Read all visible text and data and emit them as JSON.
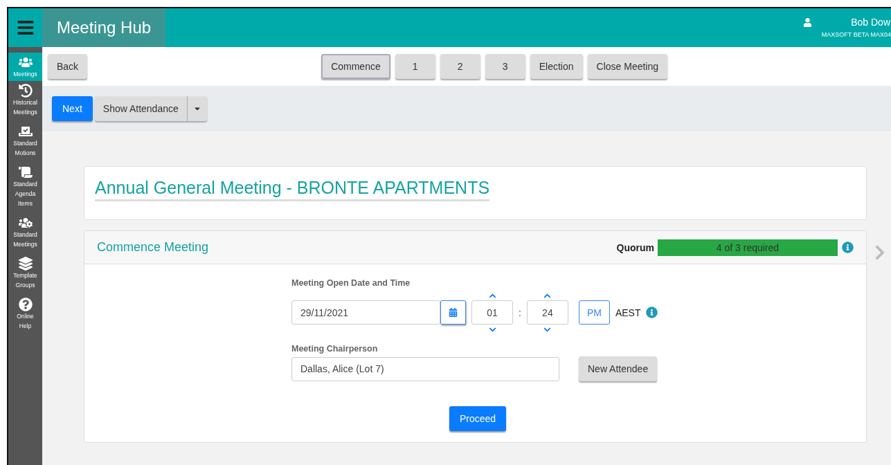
{
  "header": {
    "title": "Meeting Hub",
    "user_name": "Bob Dow",
    "user_org": "MAXSOFT BETA MAX04"
  },
  "sidebar": {
    "items": [
      {
        "label": "Meetings",
        "selected": true
      },
      {
        "label": "Historical Meetings",
        "selected": false
      },
      {
        "label": "Standard Motions",
        "selected": false
      },
      {
        "label": "Standard Agenda Items",
        "selected": false
      },
      {
        "label": "Standard Meetings",
        "selected": false
      },
      {
        "label": "Template Groups",
        "selected": false
      },
      {
        "label": "Online Help",
        "selected": false
      }
    ]
  },
  "nav": {
    "back": "Back",
    "steps": [
      {
        "label": "Commence",
        "selected": true
      },
      {
        "label": "1",
        "selected": false
      },
      {
        "label": "2",
        "selected": false
      },
      {
        "label": "3",
        "selected": false
      },
      {
        "label": "Election",
        "selected": false
      },
      {
        "label": "Close Meeting",
        "selected": false
      }
    ]
  },
  "toolbar": {
    "next": "Next",
    "show_attendance": "Show Attendance"
  },
  "meeting_title": "Annual General Meeting - BRONTE APARTMENTS",
  "commence": {
    "title": "Commence Meeting",
    "quorum_label": "Quorum",
    "quorum": {
      "text": "4 of 3 required",
      "level": 1
    },
    "date_label": "Meeting Open Date and Time",
    "date": "29/11/2021",
    "hour": "01",
    "separator": ":",
    "minute": "24",
    "ampm": "PM",
    "timezone": "AEST",
    "chair_label": "Meeting Chairperson",
    "chair": "Dallas, Alice (Lot 7)",
    "new_attendee": "New Attendee",
    "proceed": "Proceed"
  }
}
